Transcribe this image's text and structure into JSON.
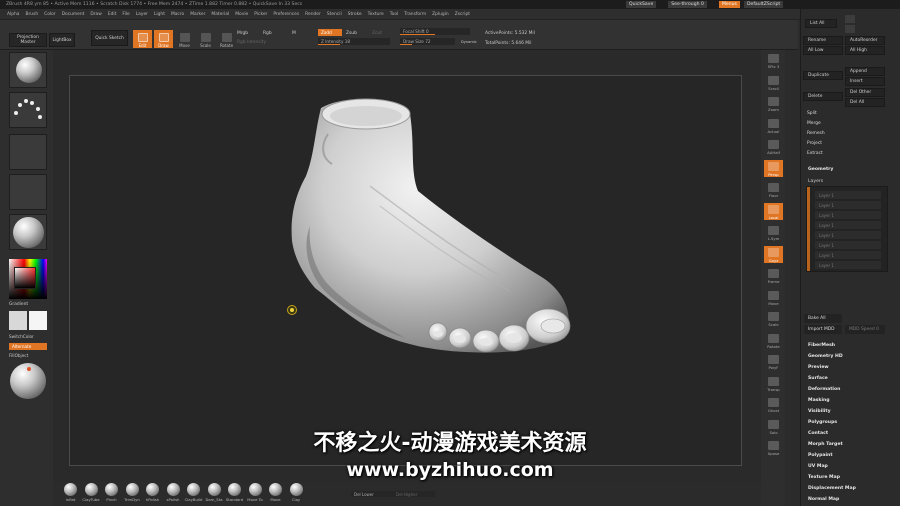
{
  "title_bar": {
    "status": "ZBrush 4R8   ym 85  • Active Mem 1116 • Scratch Disk 1774 • Free Mem 2474 • ZTime 1.882 Timer 0.882 • QuickSave In 33 Secs",
    "quicksave": "QuickSave",
    "see_through": "See-through 0",
    "menus": "Menus",
    "default_zscript": "DefaultZScript"
  },
  "menu_bar": [
    "Alpha",
    "Brush",
    "Color",
    "Document",
    "Draw",
    "Edit",
    "File",
    "Layer",
    "Light",
    "Macro",
    "Marker",
    "Material",
    "Movie",
    "Picker",
    "Preferences",
    "Render",
    "Stencil",
    "Stroke",
    "Texture",
    "Tool",
    "Transform",
    "Zplugin",
    "Zscript"
  ],
  "toolbar": {
    "projection_master": "Projection Master",
    "lightbox": "LightBox",
    "quick_sketch": "Quick Sketch",
    "tools": [
      {
        "label": "Edit",
        "active": true
      },
      {
        "label": "Draw",
        "active": true
      },
      {
        "label": "Move",
        "active": false
      },
      {
        "label": "Scale",
        "active": false
      },
      {
        "label": "Rotate",
        "active": false
      }
    ],
    "mrgb": "Mrgb",
    "rgb": "Rgb",
    "m": "M",
    "zadd": "Zadd",
    "zsub": "Zsub",
    "zcut": "Zcut",
    "rgb_intensity": "Rgb Intensity",
    "z_intensity": "Z Intensity 18",
    "focal_shift": "Focal Shift 0",
    "draw_size": "Draw Size 72",
    "dynamic": "Dynamic",
    "active_points": "ActivePoints: 5.532 Mil",
    "total_points": "TotalPoints: 5.646 Mil"
  },
  "left_shelf": {
    "gradient": "Gradient",
    "switch_color": "SwitchColor",
    "alternate": "Alternate",
    "fill_object": "FillObject"
  },
  "right_shelf": [
    {
      "label": "SPix 3",
      "active": false
    },
    {
      "label": "Scroll",
      "active": false
    },
    {
      "label": "Zoom",
      "active": false
    },
    {
      "label": "Actual",
      "active": false
    },
    {
      "label": "AAHalf",
      "active": false
    },
    {
      "label": "Persp",
      "active": true
    },
    {
      "label": "Floor",
      "active": false
    },
    {
      "label": "Local",
      "active": true
    },
    {
      "label": "L.Sym",
      "active": false
    },
    {
      "label": "Gxyz",
      "active": true
    },
    {
      "label": "Frame",
      "active": false
    },
    {
      "label": "Move",
      "active": false
    },
    {
      "label": "Scale",
      "active": false
    },
    {
      "label": "Rotate",
      "active": false
    },
    {
      "label": "PolyF",
      "active": false
    },
    {
      "label": "Transp",
      "active": false
    },
    {
      "label": "Ghost",
      "active": false
    },
    {
      "label": "Solo",
      "active": false
    },
    {
      "label": "Xpose",
      "active": false
    }
  ],
  "subtool_panel": {
    "list_all": "List All",
    "rename": "Rename",
    "auto_reorder": "AutoReorder",
    "all_low": "All Low",
    "all_high": "All High",
    "duplicate": "Duplicate",
    "append": "Append",
    "insert": "Insert",
    "delete": "Delete",
    "del_other": "Del Other",
    "del_all": "Del All",
    "split": "Split",
    "merge": "Merge",
    "remesh": "Remesh",
    "project": "Project",
    "extract": "Extract"
  },
  "tool_panel": {
    "geometry": "Geometry",
    "layers": "Layers",
    "layer_rows": [
      "Layer 1",
      "Layer 1",
      "Layer 1",
      "Layer 1",
      "Layer 1",
      "Layer 1",
      "Layer 1",
      "Layer 1"
    ],
    "bake_all": "Bake All",
    "import_mdd": "Import MDD",
    "mdd_speed": "MDD Speed 0",
    "sections": [
      "FiberMesh",
      "Geometry HD",
      "Preview",
      "Surface",
      "Deformation",
      "Masking",
      "Visibility",
      "Polygroups",
      "Contact",
      "Morph Target",
      "Polypaint",
      "UV Map",
      "Texture Map",
      "Displacement Map",
      "Normal Map"
    ]
  },
  "bottom_bar": {
    "brushes": [
      "Inflat",
      "ClayTube",
      "Pinch",
      "TrimDyn",
      "hPolish",
      "sPolish",
      "ClayBuild",
      "Dam_Sta",
      "Standard",
      "Move To",
      "Move",
      "Clay"
    ],
    "del_lower": "Del Lower",
    "del_higher": "Del Higher"
  },
  "watermark": {
    "line1": "不移之火-动漫游戏美术资源",
    "line2": "www.byzhihuo.com"
  },
  "colors": {
    "accent": "#e07524"
  }
}
